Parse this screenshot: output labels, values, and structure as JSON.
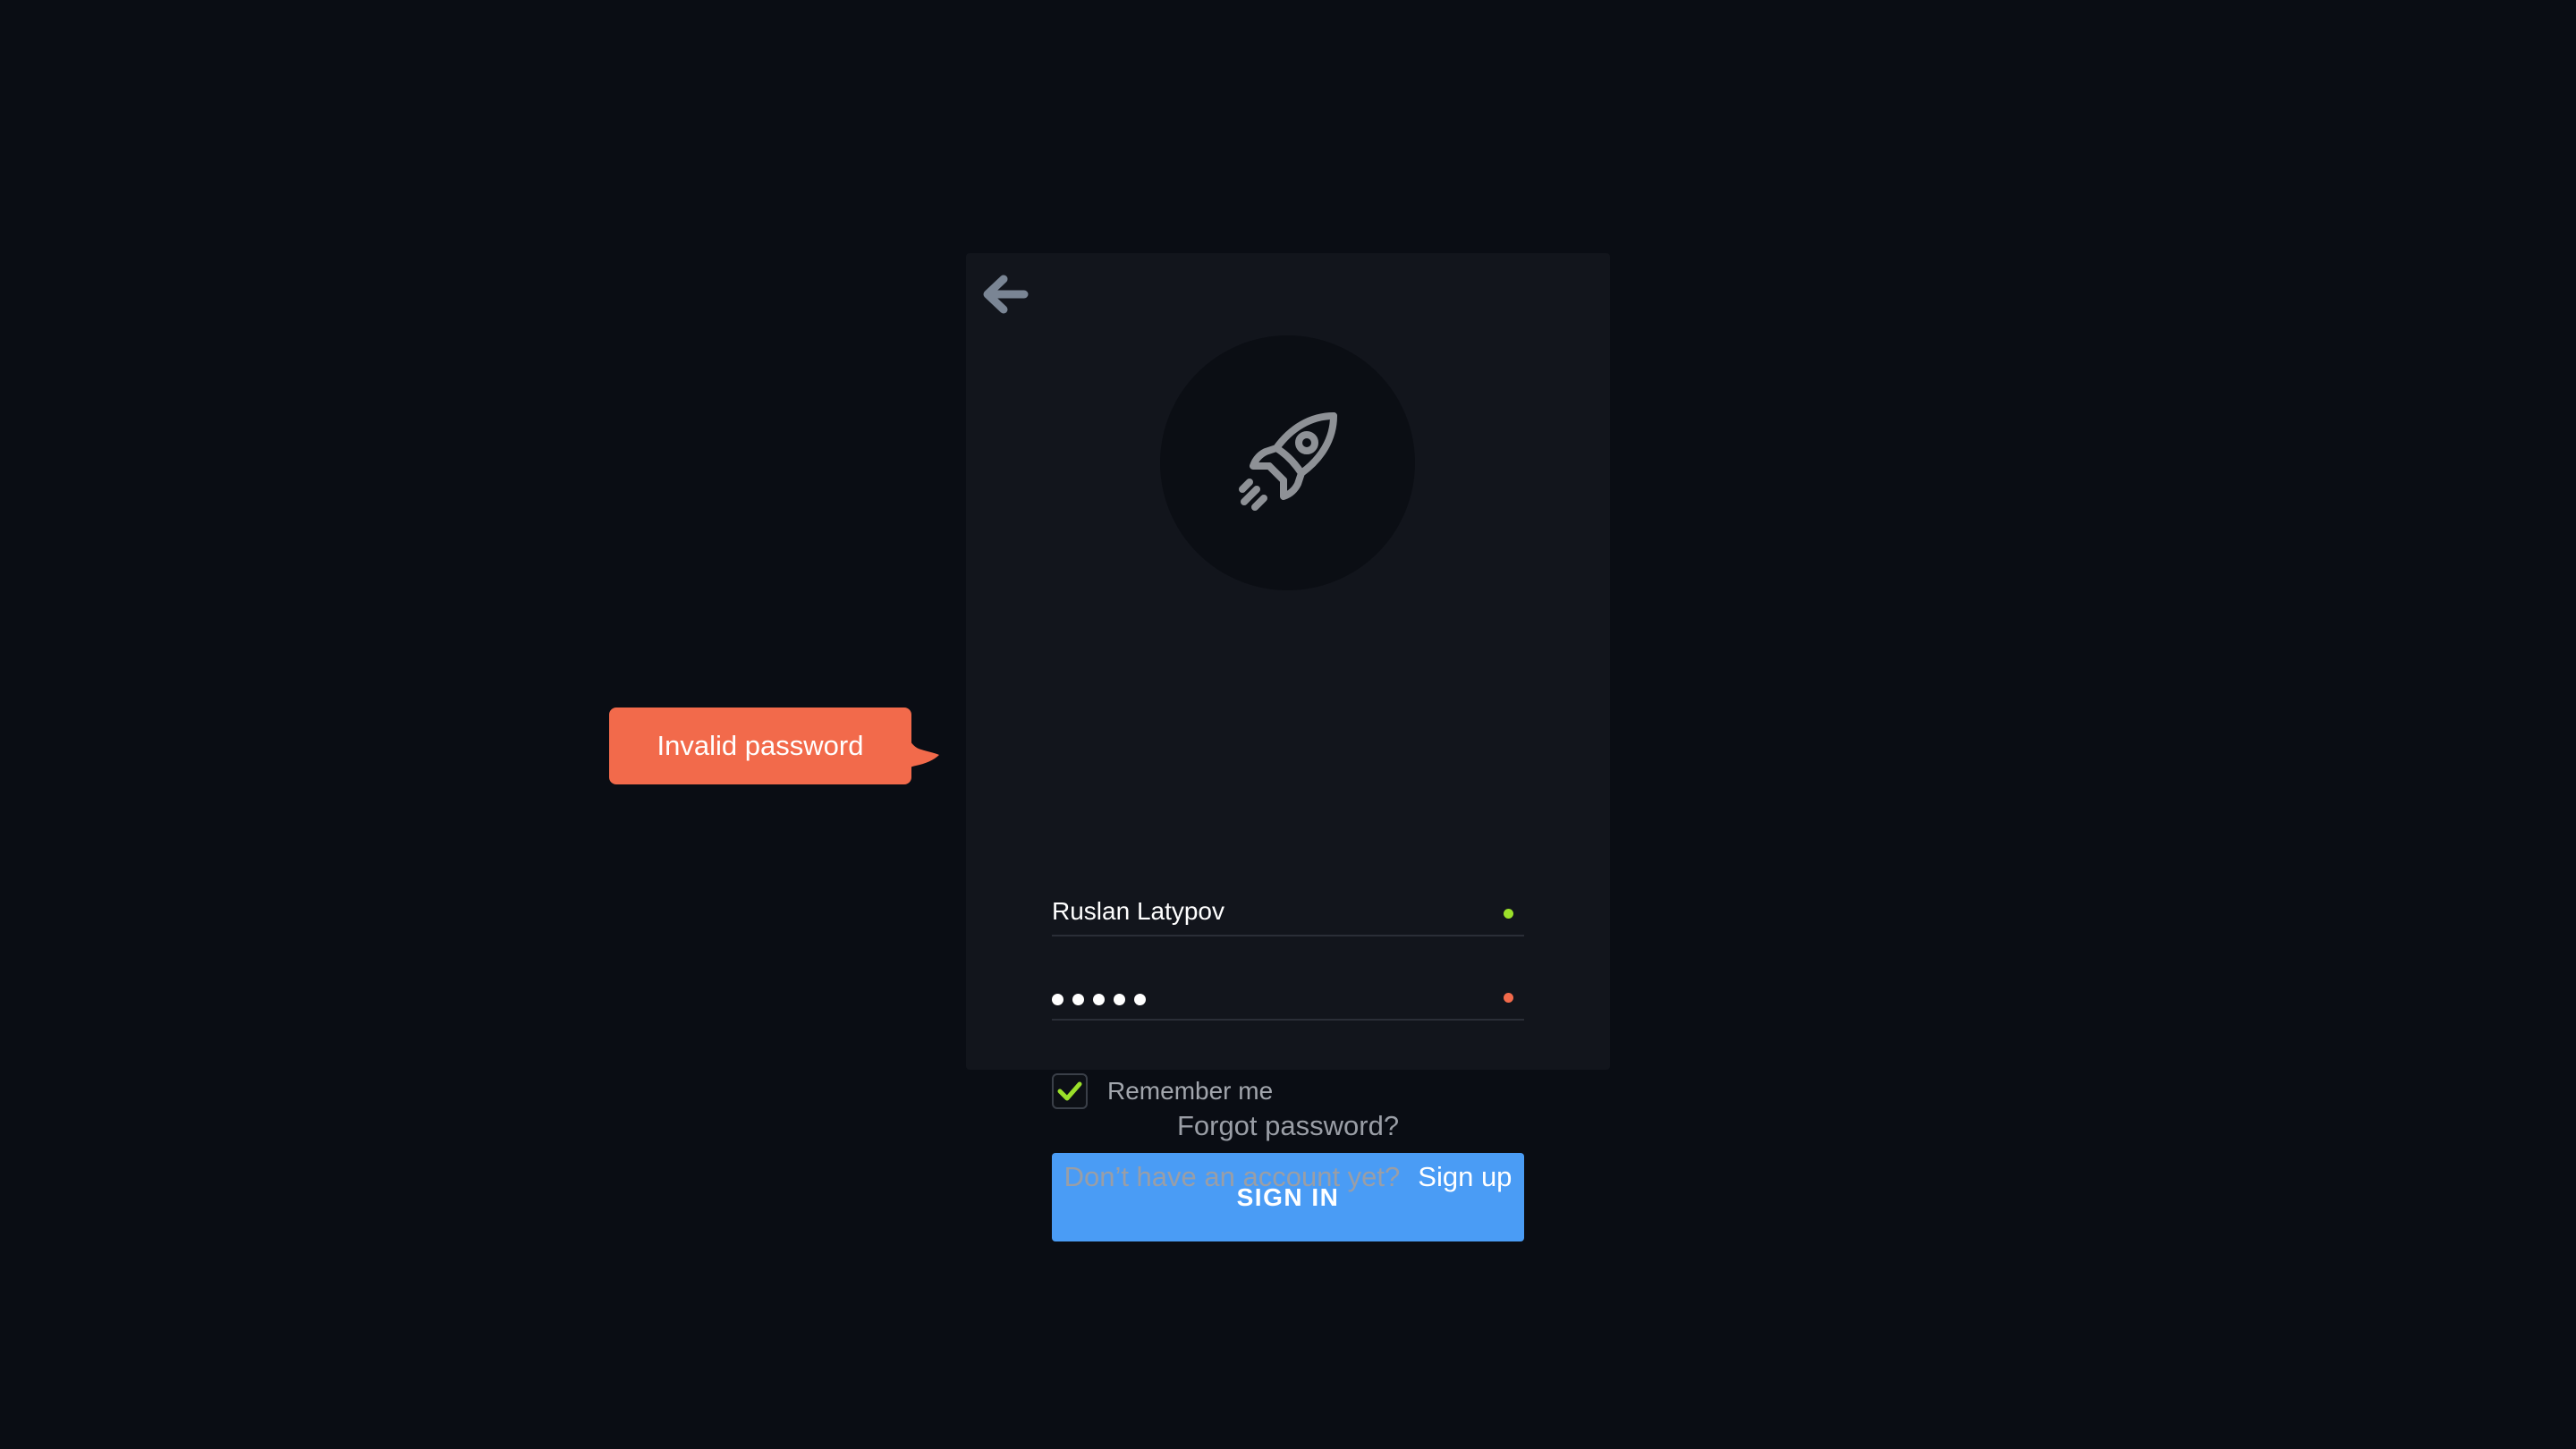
{
  "login_form": {
    "back_icon": "arrow-left-icon",
    "avatar_icon": "rocket-icon",
    "username": {
      "value": "Ruslan Latypov",
      "status_color": "#9be02a"
    },
    "password": {
      "masked_length": 5,
      "status_color": "#f26a4b"
    },
    "remember_me": {
      "label": "Remember me",
      "checked": true,
      "check_color": "#9be02a"
    },
    "sign_in_label": "SIGN IN",
    "accent_color": "#4a9cf5"
  },
  "error_tooltip": {
    "text": "Invalid password",
    "color": "#f26a4b"
  },
  "footer": {
    "forgot_password": "Forgot password?",
    "no_account_text": "Don’t have an account yet?",
    "sign_up_link": "Sign up"
  }
}
